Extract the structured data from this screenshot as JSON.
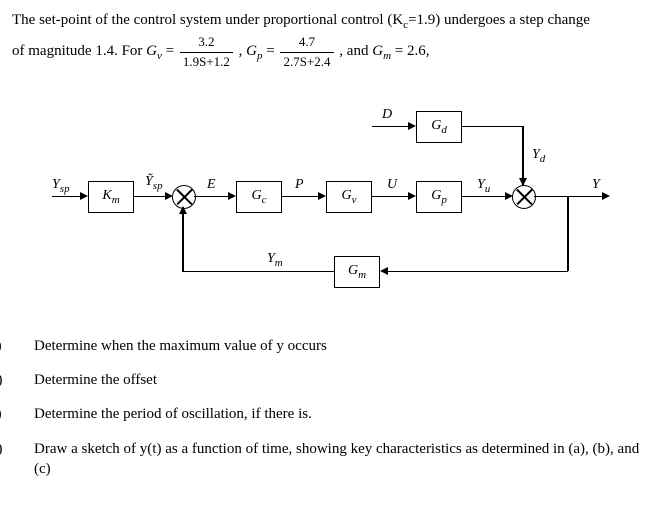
{
  "problem": {
    "intro_a": "The set-point of the control system under proportional control (K",
    "kc_sub": "c",
    "kc_eq": "=1.9) undergoes a step change",
    "line2a": "of magnitude 1.4. For ",
    "Gv_sym": "G",
    "Gv_sub": "v",
    "eq": " = ",
    "Gv_num": "3.2",
    "Gv_den": "1.9S+1.2",
    "sep": " , ",
    "Gp_sym": "G",
    "Gp_sub": "p",
    "Gp_num": "4.7",
    "Gp_den": "2.7S+2.4",
    "and": " , and ",
    "Gm_sym": "G",
    "Gm_sub": "m",
    "Gm_val": " = 2.6,"
  },
  "diagram": {
    "Km": "K",
    "Km_sub": "m",
    "Gc": "G",
    "Gc_sub": "c",
    "Gv": "G",
    "Gv_sub": "v",
    "Gp": "G",
    "Gp_sub": "p",
    "Gd": "G",
    "Gd_sub": "d",
    "Gm": "G",
    "Gm_sub": "m",
    "Ysp": "Y",
    "Ysp_sub": "sp",
    "Ytsp": "Ỹ",
    "Ytsp_sub": "sp",
    "E": "E",
    "P": "P",
    "U": "U",
    "Yu": "Y",
    "Yu_sub": "u",
    "Y": "Y",
    "D": "D",
    "Yd": "Y",
    "Yd_sub": "d",
    "Ym": "Y",
    "Ym_sub": "m"
  },
  "questions": {
    "a_tag": "a)",
    "a": "Determine when the maximum value of y occurs",
    "b_tag": "b)",
    "b": "Determine the offset",
    "c_tag": "c)",
    "c": "Determine the period of oscillation, if there is.",
    "d_tag": "d)",
    "d": "Draw a sketch of y(t) as a function of time, showing key characteristics as determined in (a), (b), and (c)"
  }
}
